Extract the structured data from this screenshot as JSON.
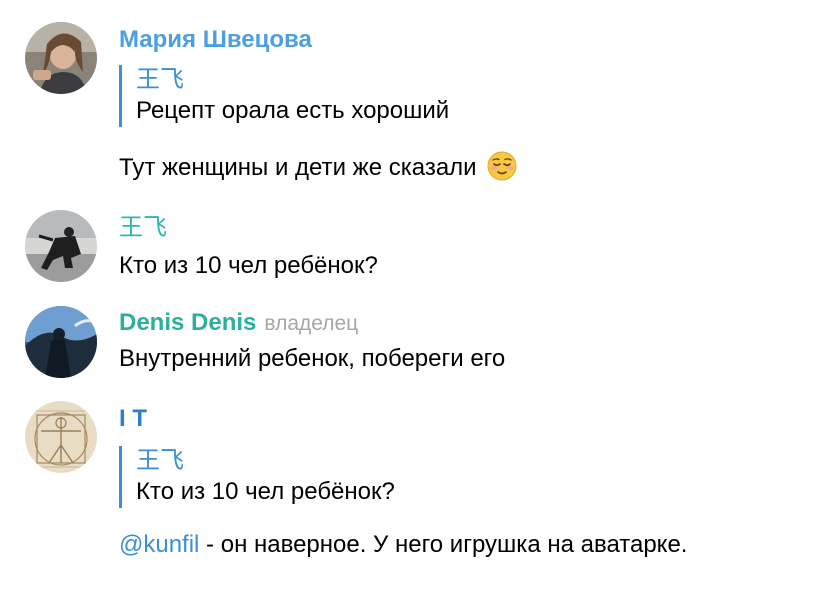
{
  "colors": {
    "name_maria": "#4c9fe0",
    "name_wang": "#2bb7b2",
    "name_denis": "#2ab09d",
    "name_it": "#2e80c9",
    "reply_bar": "#3a8fd6",
    "role": "#a4a7ab",
    "mention": "#3a8fd6"
  },
  "messages": [
    {
      "sender": "Мария Швецова",
      "reply": {
        "author": "王飞",
        "text": "Рецепт орала есть хороший"
      },
      "text": "Тут женщины и дети же сказали",
      "emoji": "relieved-face"
    },
    {
      "sender": "王飞",
      "text": "Кто из 10 чел ребёнок?"
    },
    {
      "sender": "Denis Denis",
      "role": "владелец",
      "text": "Внутренний ребенок, побереги его"
    },
    {
      "sender": "I T",
      "reply": {
        "author": "王飞",
        "text": "Кто из 10 чел ребёнок?"
      },
      "mention": "@kunfil",
      "text": " - он наверное. У него игрушка на аватарке."
    }
  ]
}
